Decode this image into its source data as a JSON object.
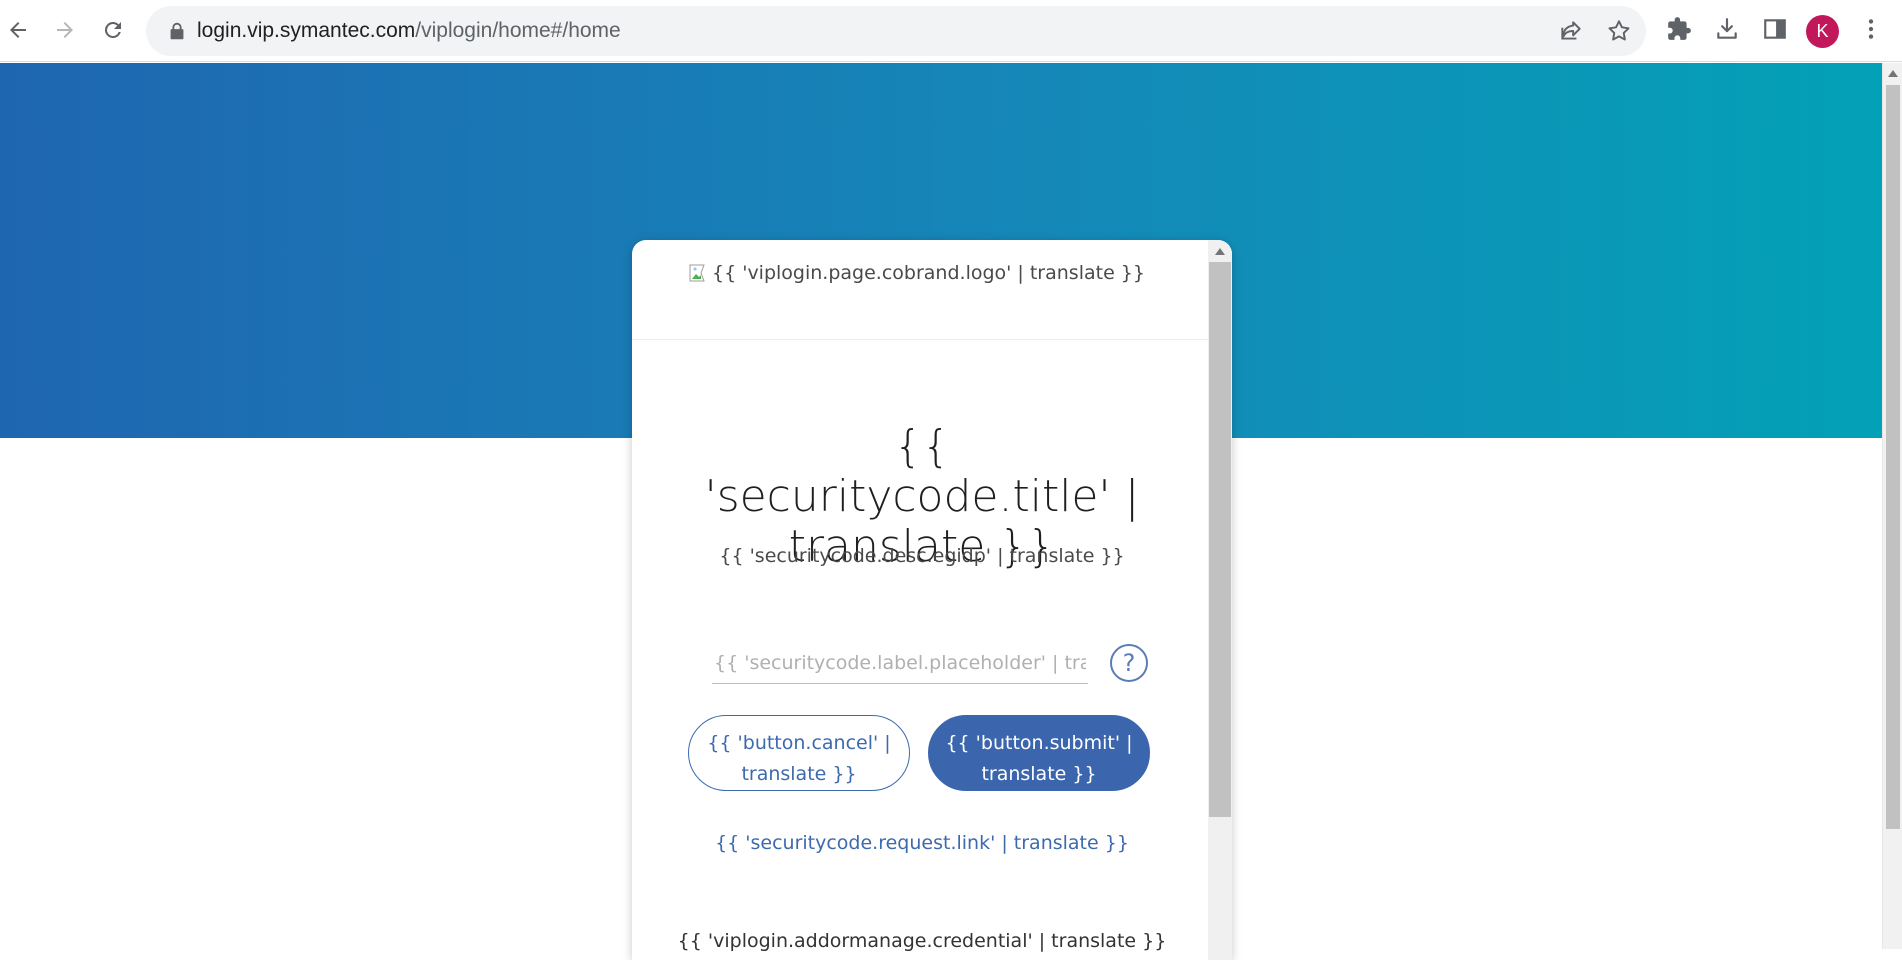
{
  "browser": {
    "url_host": "login.vip.symantec.com",
    "url_path": "/viplogin/home#/home",
    "profile_initial": "K",
    "accent_color": "#c2185b"
  },
  "card": {
    "logo_alt": "{{ 'viplogin.page.cobrand.logo' | translate }}",
    "title": "{{ 'securitycode.title' | translate }}",
    "description": "{{ 'securitycode.desc.egidp' | translate }}",
    "code_placeholder": "{{ 'securitycode.label.placeholder' | translate }}",
    "help_glyph": "?",
    "cancel_label": "{{ 'button.cancel' | translate }}",
    "submit_label": "{{ 'button.submit' | translate }}",
    "request_link": "{{ 'securitycode.request.link' | translate }}",
    "add_or_manage": "{{ 'viplogin.addormanage.credential' | translate }}"
  },
  "colors": {
    "hero_start": "#1f66b1",
    "hero_end": "#03a1b7",
    "primary": "#3b66ae"
  }
}
